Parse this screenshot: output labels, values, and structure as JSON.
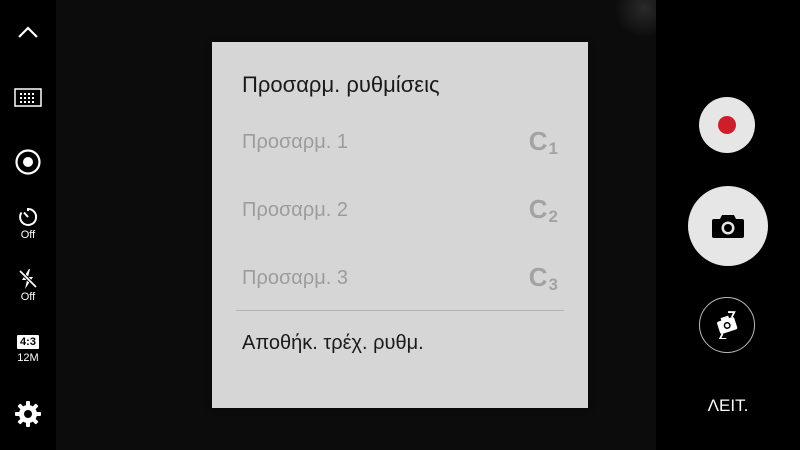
{
  "left_toolbar": {
    "items": [
      {
        "icon": "chevron-up-icon"
      },
      {
        "icon": "effects-grid-icon"
      },
      {
        "icon": "hdr-icon"
      },
      {
        "icon": "timer-icon",
        "label": "Off"
      },
      {
        "icon": "flash-off-icon",
        "label": "Off"
      },
      {
        "icon": "aspect-ratio-icon",
        "ratio": "4:3",
        "label": "12M"
      },
      {
        "icon": "gear-icon"
      }
    ]
  },
  "dialog": {
    "title": "Προσαρμ. ρυθμίσεις",
    "options": [
      {
        "label": "Προσαρμ. 1",
        "badge": "C",
        "badge_sub": "1"
      },
      {
        "label": "Προσαρμ. 2",
        "badge": "C",
        "badge_sub": "2"
      },
      {
        "label": "Προσαρμ. 3",
        "badge": "C",
        "badge_sub": "3"
      }
    ],
    "save_label": "Αποθήκ. τρέχ. ρυθμ."
  },
  "right_controls": {
    "mode_label": "ΛΕΙΤ.",
    "record_color": "#cc1f2b"
  }
}
